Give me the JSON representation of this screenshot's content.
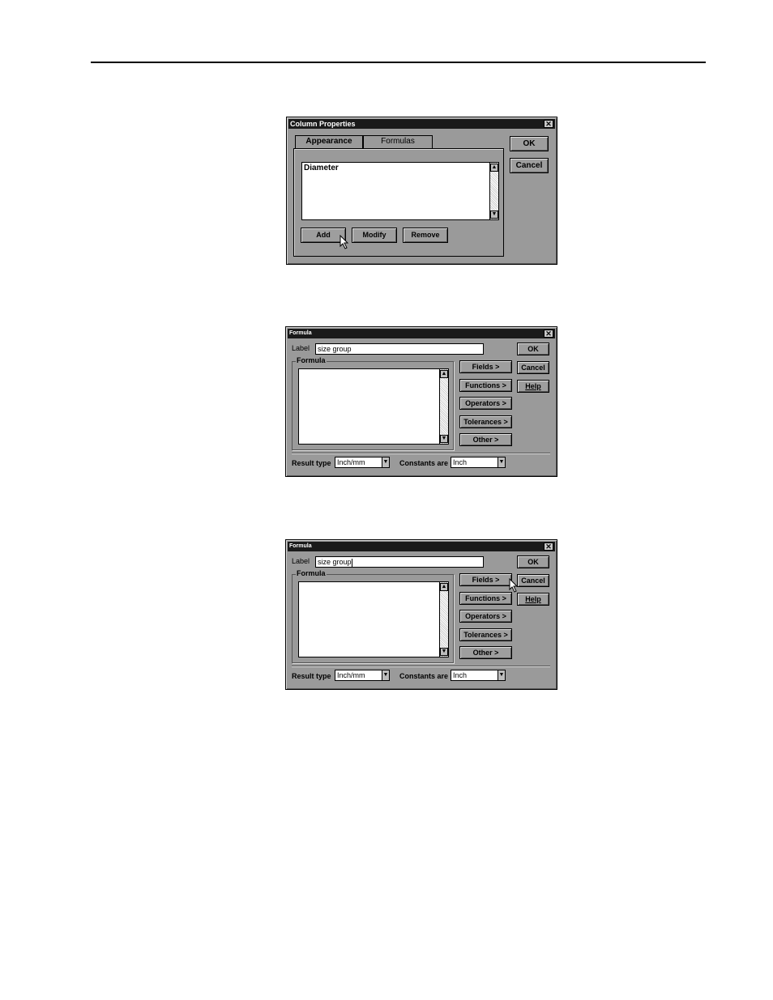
{
  "dialog1": {
    "title": "Column Properties",
    "close_glyph": "✕",
    "tabs": [
      "Appearance",
      "Formulas"
    ],
    "list_items": [
      "Diameter"
    ],
    "buttons": {
      "add": "Add",
      "modify": "Modify",
      "remove": "Remove",
      "ok": "OK",
      "cancel": "Cancel"
    }
  },
  "dialog2": {
    "title": "Formula",
    "close_glyph": "✕",
    "label_caption": "Label",
    "label_value": "size group",
    "formula_group": "Formula",
    "side_buttons": [
      "Fields >",
      "Functions >",
      "Operators >",
      "Tolerances >",
      "Other >"
    ],
    "buttons": {
      "ok": "OK",
      "cancel": "Cancel",
      "help": "Help"
    },
    "result_type_caption": "Result type",
    "result_type_value": "Inch/mm",
    "constants_caption": "Constants are",
    "constants_value": "Inch"
  },
  "dialog3": {
    "title": "Formula",
    "close_glyph": "✕",
    "label_caption": "Label",
    "label_value": "size group",
    "formula_group": "Formula",
    "side_buttons": [
      "Fields >",
      "Functions >",
      "Operators >",
      "Tolerances >",
      "Other >"
    ],
    "buttons": {
      "ok": "OK",
      "cancel": "Cancel",
      "help": "Help"
    },
    "result_type_caption": "Result type",
    "result_type_value": "Inch/mm",
    "constants_caption": "Constants are",
    "constants_value": "Inch"
  },
  "icons": {
    "scroll_up": "up-arrow-icon",
    "scroll_down": "down-arrow-icon",
    "dropdown": "chevron-down-icon",
    "cursor": "mouse-pointer-icon"
  }
}
